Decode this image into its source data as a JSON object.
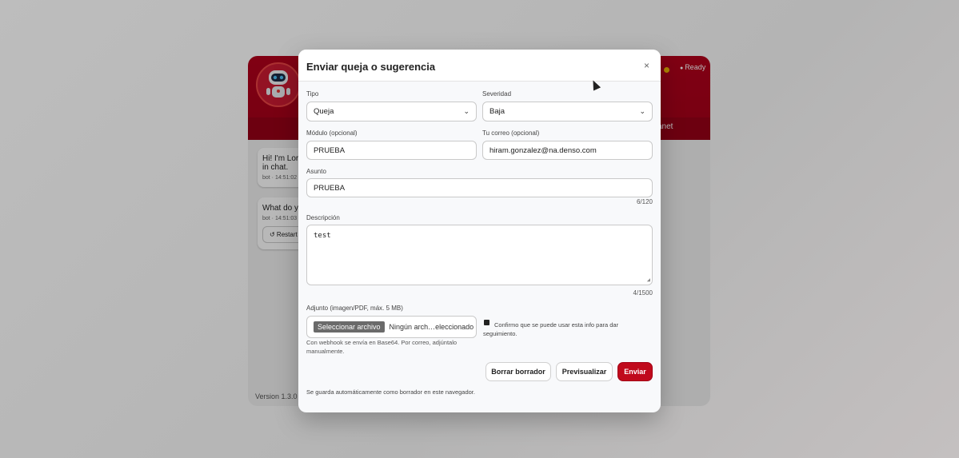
{
  "background_app": {
    "ready_label": "Ready",
    "tab_label": "anet",
    "messages": [
      {
        "text": "Hi! I'm Lor\nin chat.",
        "meta": "bot · 14:51:02"
      },
      {
        "text": "What do y",
        "meta": "bot · 14:51:03",
        "button": "↺ Restart"
      }
    ],
    "version": "Version 1.3.0"
  },
  "modal": {
    "title": "Enviar queja o sugerencia",
    "close_icon": "×",
    "tipo": {
      "label": "Tipo",
      "value": "Queja"
    },
    "severidad": {
      "label": "Severidad",
      "value": "Baja"
    },
    "modulo": {
      "label": "Módulo (opcional)",
      "value": "PRUEBA"
    },
    "correo": {
      "label": "Tu correo (opcional)",
      "value": "hiram.gonzalez@na.denso.com"
    },
    "asunto": {
      "label": "Asunto",
      "value": "PRUEBA",
      "counter": "6/120"
    },
    "descripcion": {
      "label": "Descripción",
      "value": "test",
      "counter": "4/1500"
    },
    "adjunto": {
      "label": "Adjunto (imagen/PDF, máx. 5 MB)",
      "button": "Seleccionar archivo",
      "status": "Ningún arch…eleccionado",
      "hint": "Con webhook se envía en Base64. Por correo, adjúntalo manualmente."
    },
    "confirm": {
      "checked": true,
      "label": "Confirmo que se puede usar esta info para dar seguimiento."
    },
    "buttons": {
      "clear": "Borrar borrador",
      "preview": "Previsualizar",
      "send": "Enviar"
    },
    "autosave_note": "Se guarda automáticamente como borrador en este navegador."
  },
  "colors": {
    "brand": "#b3001b",
    "primary_button": "#c00a1c"
  }
}
